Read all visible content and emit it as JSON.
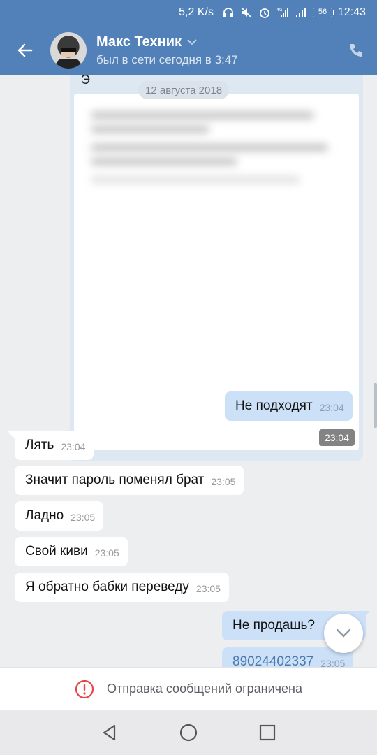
{
  "status_bar": {
    "network_speed": "5,2 K/s",
    "network_type": "4G",
    "battery": "56",
    "time": "12:43"
  },
  "header": {
    "contact_name": "Макс Техник",
    "contact_status": "был в сети сегодня в 3:47"
  },
  "chat": {
    "date_chip": "12 августа 2018",
    "forwarded_letter": "Э",
    "forwarded_image_time": "23:04",
    "messages": [
      {
        "direction": "out",
        "text": "Не подходят",
        "time": "23:04"
      },
      {
        "direction": "in",
        "text": "Лять",
        "time": "23:04"
      },
      {
        "direction": "in",
        "text": "Значит пароль поменял брат",
        "time": "23:05"
      },
      {
        "direction": "in",
        "text": "Ладно",
        "time": "23:05"
      },
      {
        "direction": "in",
        "text": "Свой киви",
        "time": "23:05"
      },
      {
        "direction": "in",
        "text": "Я обратно бабки переведу",
        "time": "23:05"
      },
      {
        "direction": "out",
        "text": "Не продашь?",
        "time": ""
      },
      {
        "direction": "out",
        "text": "89024402337",
        "time": "23:05"
      }
    ]
  },
  "restriction": {
    "text": "Отправка сообщений ограничена"
  },
  "colors": {
    "header_bg": "#5181b8",
    "chat_bg": "#edeef0",
    "outgoing_bubble": "#cce0f7",
    "incoming_bubble": "#ffffff",
    "warning_red": "#e64646"
  },
  "icons": {
    "back": "arrow-left-icon",
    "call": "phone-icon",
    "dropdown": "chevron-down-icon",
    "scroll_down": "chevron-down-icon",
    "warning": "exclamation-circle-icon",
    "nav_back": "triangle-back-icon",
    "nav_home": "circle-home-icon",
    "nav_recent": "square-recent-icon"
  }
}
